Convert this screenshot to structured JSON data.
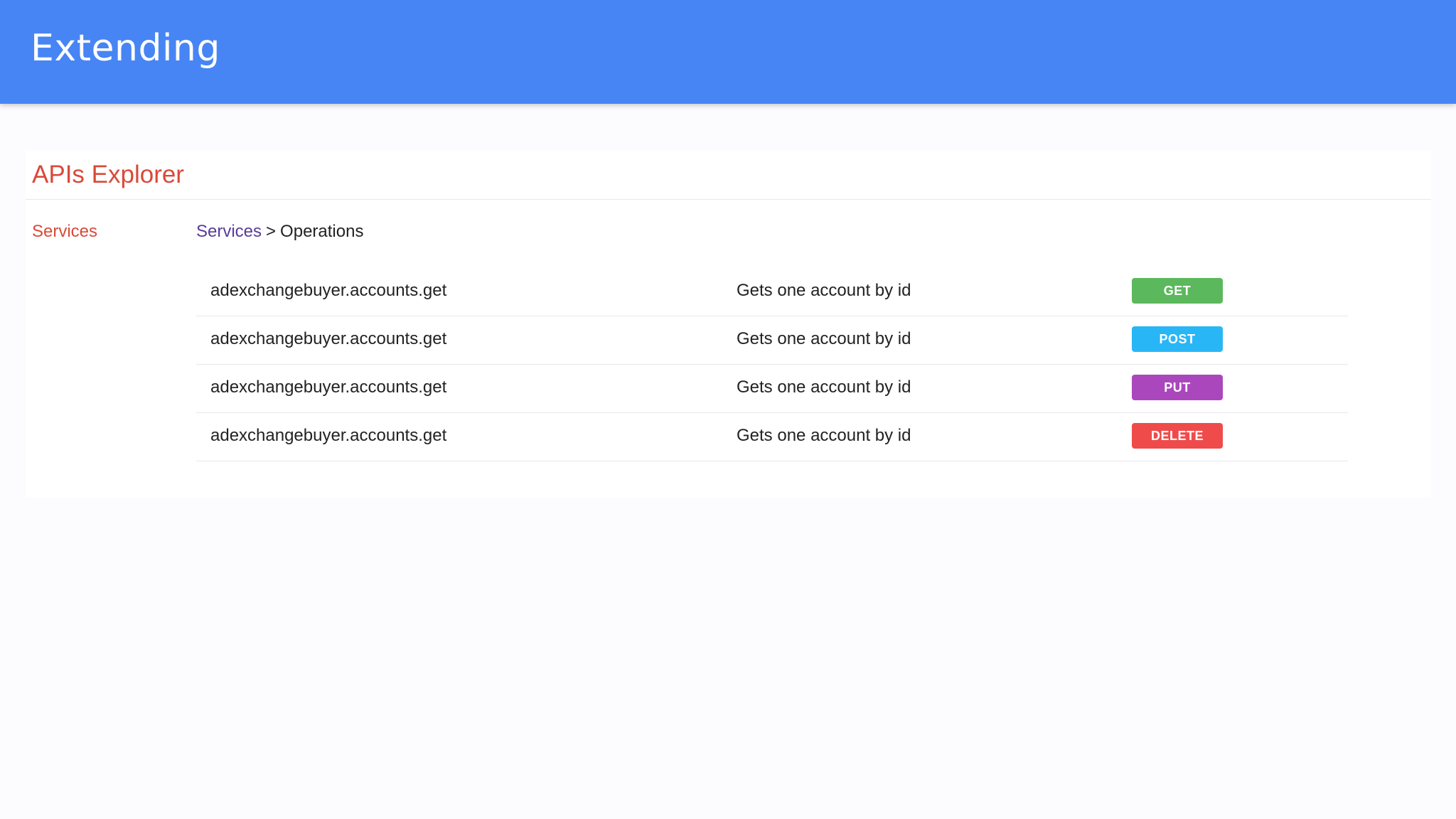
{
  "header": {
    "title": "Extending"
  },
  "explorer": {
    "title": "APIs Explorer",
    "sidebar_link": "Services",
    "breadcrumb": {
      "link": "Services",
      "separator": ">",
      "current": "Operations"
    }
  },
  "operations": [
    {
      "name": "adexchangebuyer.accounts.get",
      "description": "Gets one account by id",
      "method": "GET"
    },
    {
      "name": "adexchangebuyer.accounts.get",
      "description": "Gets one account by id",
      "method": "POST"
    },
    {
      "name": "adexchangebuyer.accounts.get",
      "description": "Gets one account by id",
      "method": "PUT"
    },
    {
      "name": "adexchangebuyer.accounts.get",
      "description": "Gets one account by id",
      "method": "DELETE"
    }
  ],
  "colors": {
    "header_bg": "#4785f4",
    "accent_red": "#d94a38",
    "link_purple": "#5b3a9a",
    "get": "#5cb85c",
    "post": "#29b6f6",
    "put": "#ab47bc",
    "delete": "#ef4b4b"
  }
}
